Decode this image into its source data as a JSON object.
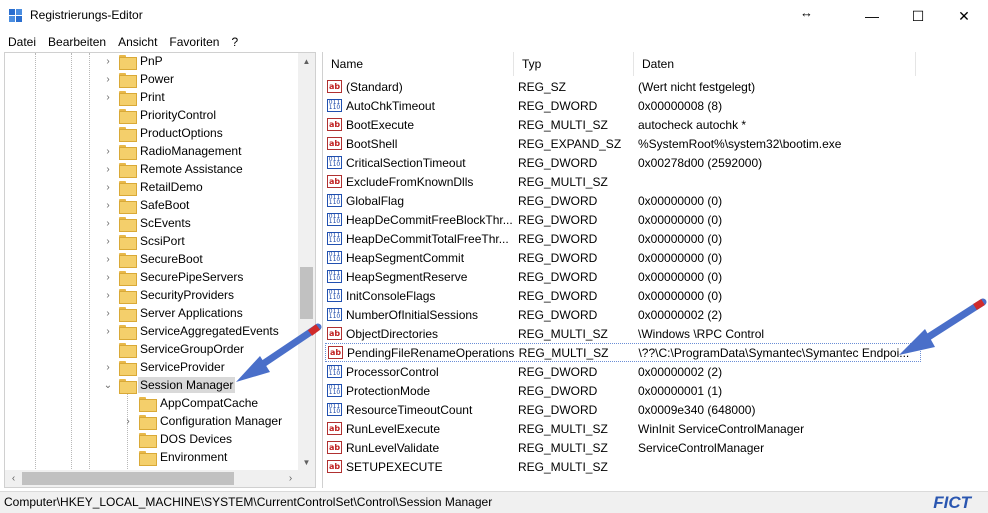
{
  "window": {
    "title": "Registrierungs-Editor",
    "resize_glyph": "↔",
    "minimize_glyph": "—",
    "maximize_glyph": "☐",
    "close_glyph": "✕"
  },
  "menu": [
    "Datei",
    "Bearbeiten",
    "Ansicht",
    "Favoriten",
    "?"
  ],
  "tree": {
    "items": [
      {
        "label": "PnP",
        "expandable": true
      },
      {
        "label": "Power",
        "expandable": true
      },
      {
        "label": "Print",
        "expandable": true
      },
      {
        "label": "PriorityControl",
        "expandable": false
      },
      {
        "label": "ProductOptions",
        "expandable": false
      },
      {
        "label": "RadioManagement",
        "expandable": true
      },
      {
        "label": "Remote Assistance",
        "expandable": true
      },
      {
        "label": "RetailDemo",
        "expandable": true
      },
      {
        "label": "SafeBoot",
        "expandable": true
      },
      {
        "label": "ScEvents",
        "expandable": true
      },
      {
        "label": "ScsiPort",
        "expandable": true
      },
      {
        "label": "SecureBoot",
        "expandable": true
      },
      {
        "label": "SecurePipeServers",
        "expandable": true
      },
      {
        "label": "SecurityProviders",
        "expandable": true
      },
      {
        "label": "Server Applications",
        "expandable": true
      },
      {
        "label": "ServiceAggregatedEvents",
        "expandable": true
      },
      {
        "label": "ServiceGroupOrder",
        "expandable": false
      },
      {
        "label": "ServiceProvider",
        "expandable": true
      },
      {
        "label": "Session Manager",
        "expandable": true,
        "expanded": true,
        "selected": true
      }
    ],
    "children": [
      {
        "label": "AppCompatCache",
        "expandable": false
      },
      {
        "label": "Configuration Manager",
        "expandable": true
      },
      {
        "label": "DOS Devices",
        "expandable": false
      },
      {
        "label": "Environment",
        "expandable": false
      }
    ]
  },
  "list": {
    "columns": [
      "Name",
      "Typ",
      "Daten"
    ],
    "rows": [
      {
        "icon": "string-value-icon",
        "name": "(Standard)",
        "type": "REG_SZ",
        "data": "(Wert nicht festgelegt)"
      },
      {
        "icon": "binary-value-icon",
        "name": "AutoChkTimeout",
        "type": "REG_DWORD",
        "data": "0x00000008 (8)"
      },
      {
        "icon": "string-value-icon",
        "name": "BootExecute",
        "type": "REG_MULTI_SZ",
        "data": "autocheck autochk *"
      },
      {
        "icon": "string-value-icon",
        "name": "BootShell",
        "type": "REG_EXPAND_SZ",
        "data": "%SystemRoot%\\system32\\bootim.exe"
      },
      {
        "icon": "binary-value-icon",
        "name": "CriticalSectionTimeout",
        "type": "REG_DWORD",
        "data": "0x00278d00 (2592000)"
      },
      {
        "icon": "string-value-icon",
        "name": "ExcludeFromKnownDlls",
        "type": "REG_MULTI_SZ",
        "data": ""
      },
      {
        "icon": "binary-value-icon",
        "name": "GlobalFlag",
        "type": "REG_DWORD",
        "data": "0x00000000 (0)"
      },
      {
        "icon": "binary-value-icon",
        "name": "HeapDeCommitFreeBlockThr...",
        "type": "REG_DWORD",
        "data": "0x00000000 (0)"
      },
      {
        "icon": "binary-value-icon",
        "name": "HeapDeCommitTotalFreeThr...",
        "type": "REG_DWORD",
        "data": "0x00000000 (0)"
      },
      {
        "icon": "binary-value-icon",
        "name": "HeapSegmentCommit",
        "type": "REG_DWORD",
        "data": "0x00000000 (0)"
      },
      {
        "icon": "binary-value-icon",
        "name": "HeapSegmentReserve",
        "type": "REG_DWORD",
        "data": "0x00000000 (0)"
      },
      {
        "icon": "binary-value-icon",
        "name": "InitConsoleFlags",
        "type": "REG_DWORD",
        "data": "0x00000000 (0)"
      },
      {
        "icon": "binary-value-icon",
        "name": "NumberOfInitialSessions",
        "type": "REG_DWORD",
        "data": "0x00000002 (2)"
      },
      {
        "icon": "string-value-icon",
        "name": "ObjectDirectories",
        "type": "REG_MULTI_SZ",
        "data": "\\Windows \\RPC Control"
      },
      {
        "icon": "string-value-icon",
        "name": "PendingFileRenameOperations",
        "type": "REG_MULTI_SZ",
        "data": "\\??\\C:\\ProgramData\\Symantec\\Symantec Endpoi...",
        "selected": true
      },
      {
        "icon": "binary-value-icon",
        "name": "ProcessorControl",
        "type": "REG_DWORD",
        "data": "0x00000002 (2)"
      },
      {
        "icon": "binary-value-icon",
        "name": "ProtectionMode",
        "type": "REG_DWORD",
        "data": "0x00000001 (1)"
      },
      {
        "icon": "binary-value-icon",
        "name": "ResourceTimeoutCount",
        "type": "REG_DWORD",
        "data": "0x0009e340 (648000)"
      },
      {
        "icon": "string-value-icon",
        "name": "RunLevelExecute",
        "type": "REG_MULTI_SZ",
        "data": "WinInit ServiceControlManager"
      },
      {
        "icon": "string-value-icon",
        "name": "RunLevelValidate",
        "type": "REG_MULTI_SZ",
        "data": "ServiceControlManager"
      },
      {
        "icon": "string-value-icon",
        "name": "SETUPEXECUTE",
        "type": "REG_MULTI_SZ",
        "data": ""
      }
    ]
  },
  "status": {
    "path": "Computer\\HKEY_LOCAL_MACHINE\\SYSTEM\\CurrentControlSet\\Control\\Session Manager",
    "watermark": "FICT"
  },
  "colors": {
    "arrow": "#4a6fc9",
    "arrow_tip": "#d02b2b",
    "watermark": "#2a56b0"
  }
}
